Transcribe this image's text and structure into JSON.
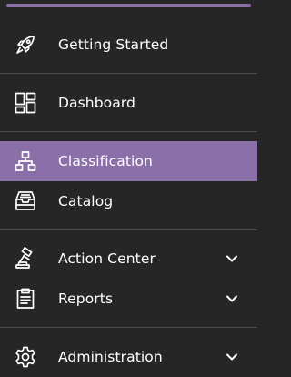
{
  "colors": {
    "background": "#262626",
    "accent": "#8a6fa8",
    "text": "#ffffff",
    "divider": "#4a4a4a"
  },
  "nav": {
    "items": [
      {
        "label": "Getting Started",
        "icon": "rocket-icon",
        "active": false,
        "expandable": false
      },
      {
        "label": "Dashboard",
        "icon": "dashboard-icon",
        "active": false,
        "expandable": false
      },
      {
        "label": "Classification",
        "icon": "hierarchy-icon",
        "active": true,
        "expandable": false
      },
      {
        "label": "Catalog",
        "icon": "tray-icon",
        "active": false,
        "expandable": false
      },
      {
        "label": "Action Center",
        "icon": "gavel-icon",
        "active": false,
        "expandable": true
      },
      {
        "label": "Reports",
        "icon": "clipboard-icon",
        "active": false,
        "expandable": true
      },
      {
        "label": "Administration",
        "icon": "gear-icon",
        "active": false,
        "expandable": true
      }
    ]
  }
}
